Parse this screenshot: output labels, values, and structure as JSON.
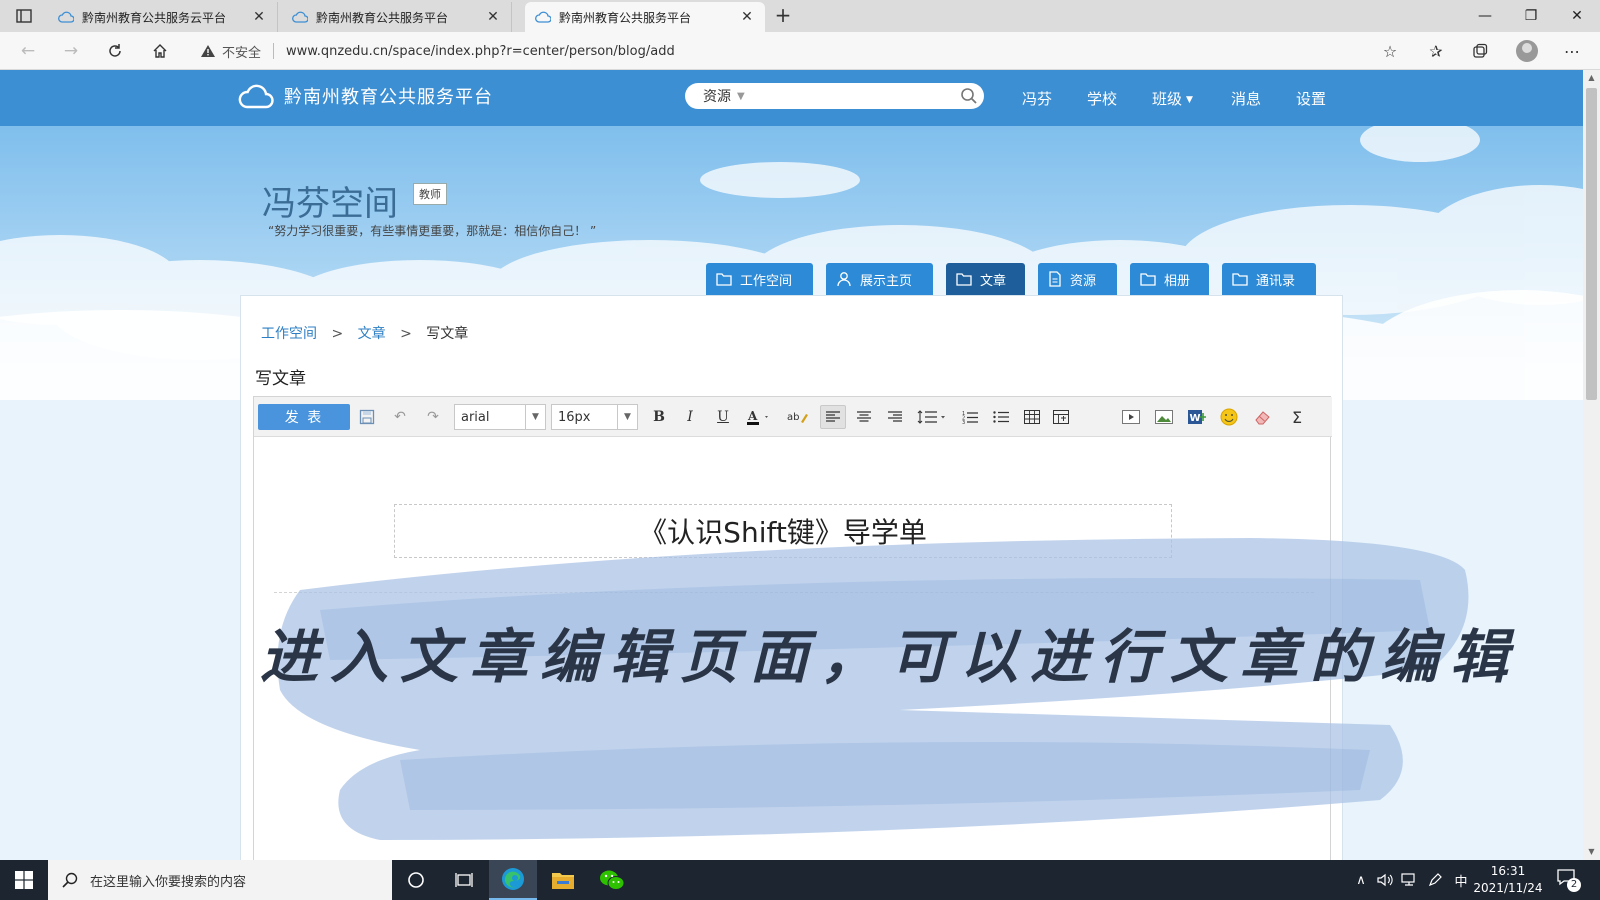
{
  "browser": {
    "tabs": [
      {
        "title": "黔南州教育公共服务云平台",
        "active": false
      },
      {
        "title": "黔南州教育公共服务平台",
        "active": false
      },
      {
        "title": "黔南州教育公共服务平台",
        "active": true
      }
    ],
    "security_label": "不安全",
    "url": "www.qnzedu.cn/space/index.php?r=center/person/blog/add"
  },
  "site": {
    "logo_text": "黔南州教育公共服务平台",
    "search": {
      "category": "资源",
      "placeholder": ""
    },
    "nav": [
      {
        "label": "冯芬",
        "dropdown": false
      },
      {
        "label": "学校",
        "dropdown": false
      },
      {
        "label": "班级",
        "dropdown": true
      },
      {
        "label": "消息",
        "dropdown": false
      },
      {
        "label": "设置",
        "dropdown": false
      }
    ]
  },
  "space": {
    "title": "冯芬空间",
    "badge": "教师",
    "motto": "“努力学习很重要，有些事情更重要，那就是：相信你自己！ ”",
    "tabs": [
      {
        "label": "工作空间",
        "icon": "folder-icon",
        "active": false
      },
      {
        "label": "展示主页",
        "icon": "user-icon",
        "active": false
      },
      {
        "label": "文章",
        "icon": "folder-icon",
        "active": true
      },
      {
        "label": "资源",
        "icon": "document-icon",
        "active": false
      },
      {
        "label": "相册",
        "icon": "folder-icon",
        "active": false
      },
      {
        "label": "通讯录",
        "icon": "folder-icon",
        "active": false
      }
    ]
  },
  "breadcrumb": {
    "items": [
      "工作空间",
      "文章"
    ],
    "separator": ">",
    "current": "写文章"
  },
  "page_title": "写文章",
  "editor": {
    "publish_label": "发 表",
    "font_family": "arial",
    "font_size": "16px",
    "doc_title": "《认识Shift键》导学单"
  },
  "overlay_caption": "进入文章编辑页面，可以进行文章的编辑",
  "taskbar": {
    "search_placeholder": "在这里输入你要搜索的内容",
    "ime": "中",
    "time": "16:31",
    "date": "2021/11/24",
    "notification_count": "2"
  },
  "colors": {
    "nav_blue": "#3d8fd4",
    "tab_blue": "#2d8ad6",
    "tab_active": "#1e5f9b",
    "link_blue": "#2d7fc4",
    "publish_blue": "#4a94dd"
  }
}
